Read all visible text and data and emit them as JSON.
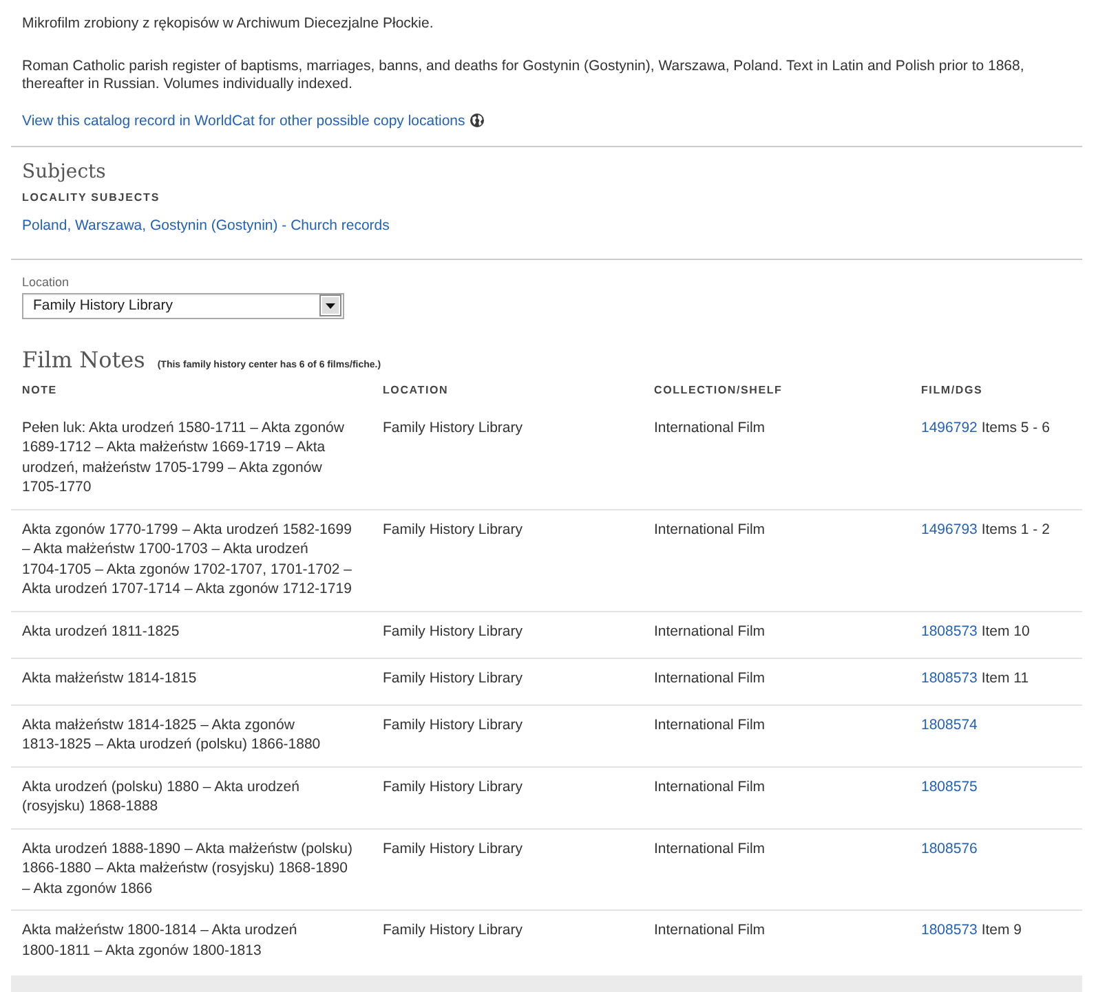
{
  "description": {
    "paragraphs": [
      "Mikrofilm zrobiony z rękopisów w Archiwum Diecezjalne Płockie.",
      "Roman Catholic parish register of baptisms, marriages, banns, and deaths for Gostynin (Gostynin), Warszawa, Poland. Text in Latin and Polish prior to 1868, thereafter in Russian. Volumes individually indexed."
    ],
    "worldcat_link": "View this catalog record in WorldCat for other possible copy locations"
  },
  "subjects": {
    "title": "Subjects",
    "groups": [
      {
        "heading": "LOCALITY SUBJECTS",
        "links": [
          "Poland, Warszawa, Gostynin (Gostynin) - Church records"
        ]
      }
    ]
  },
  "location_filter": {
    "label": "Location",
    "value": "Family History Library"
  },
  "film_notes": {
    "title": "Film Notes",
    "availability": "(This family history center has 6 of 6 films/fiche.)",
    "columns": [
      "NOTE",
      "LOCATION",
      "COLLECTION/SHELF",
      "FILM/DGS"
    ],
    "rows": [
      {
        "note": "Pełen luk: Akta urodzeń 1580-1711 – Akta zgonów 1689-1712 – Akta małżeństw 1669-1719 – Akta urodzeń, małżeństw 1705-1799 – Akta zgonów 1705-1770",
        "location": "Family History Library",
        "collection": "International Film",
        "film": "1496792",
        "items": "Items 5 - 6"
      },
      {
        "note": "Akta zgonów 1770-1799 – Akta urodzeń 1582-1699 – Akta małżeństw 1700-1703 – Akta urodzeń 1704-1705 – Akta zgonów 1702-1707, 1701-1702 – Akta urodzeń 1707-1714 – Akta zgonów 1712-1719",
        "location": "Family History Library",
        "collection": "International Film",
        "film": "1496793",
        "items": "Items 1 - 2"
      },
      {
        "note": "Akta urodzeń 1811-1825",
        "location": "Family History Library",
        "collection": "International Film",
        "film": "1808573",
        "items": "Item 10"
      },
      {
        "note": "Akta małżeństw 1814-1815",
        "location": "Family History Library",
        "collection": "International Film",
        "film": "1808573",
        "items": "Item 11"
      },
      {
        "note": "Akta małżeństw 1814-1825 – Akta zgonów 1813-1825 – Akta urodzeń (polsku) 1866-1880",
        "location": "Family History Library",
        "collection": "International Film",
        "film": "1808574"
      },
      {
        "note": "Akta urodzeń (polsku) 1880 – Akta urodzeń (rosyjsku) 1868-1888",
        "location": "Family History Library",
        "collection": "International Film",
        "film": "1808575"
      },
      {
        "note": "Akta urodzeń 1888-1890 – Akta małżeństw (polsku) 1866-1880 – Akta małżeństw (rosyjsku) 1868-1890 – Akta zgonów 1866",
        "location": "Family History Library",
        "collection": "International Film",
        "film": "1808576"
      },
      {
        "note": "Akta małżeństw 1800-1814 – Akta urodzeń 1800-1811 – Akta zgonów 1800-1813",
        "location": "Family History Library",
        "collection": "International Film",
        "film": "1808573",
        "items": "Item 9"
      }
    ]
  }
}
